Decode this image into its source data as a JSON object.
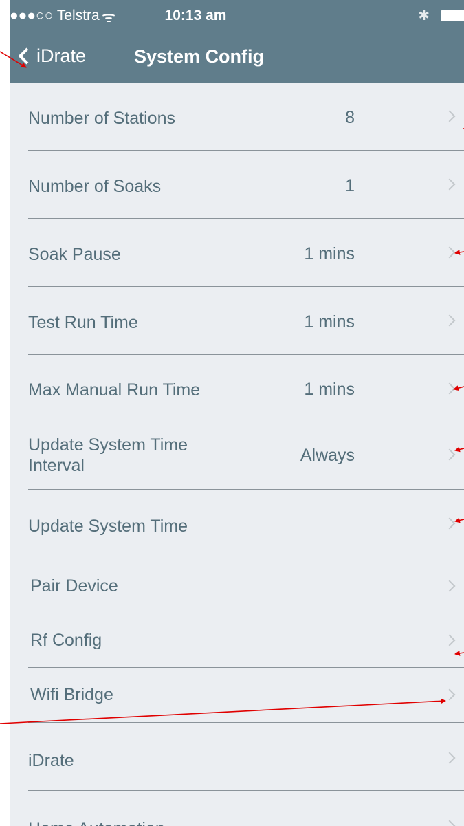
{
  "status_bar": {
    "carrier": "●●●○○ Telstra",
    "wifi_icon": "wifi-icon",
    "time": "10:13 am",
    "bluetooth_icon": "bluetooth-icon",
    "battery_icon": "battery-icon"
  },
  "nav": {
    "back_label": "iDrate",
    "title": "System Config"
  },
  "rows": [
    {
      "label": "Number of Stations",
      "value": "8"
    },
    {
      "label": "Number of Soaks",
      "value": "1"
    },
    {
      "label": "Soak Pause",
      "value": "1 mins"
    },
    {
      "label": "Test Run Time",
      "value": "1 mins"
    },
    {
      "label": "Max Manual Run Time",
      "value": "1 mins"
    },
    {
      "label": "Update System Time Interval",
      "value": "Always"
    },
    {
      "label": "Update System Time",
      "value": ""
    },
    {
      "label": "Pair Device",
      "value": ""
    },
    {
      "label": "Rf Config",
      "value": ""
    },
    {
      "label": "Wifi Bridge",
      "value": ""
    },
    {
      "label": "iDrate",
      "value": ""
    },
    {
      "label": "Home Automation",
      "value": ""
    }
  ],
  "colors": {
    "header_bg": "#607d8b",
    "list_bg": "#ebeef2",
    "text": "#546e7a",
    "annotation_arrow": "#e00000"
  }
}
